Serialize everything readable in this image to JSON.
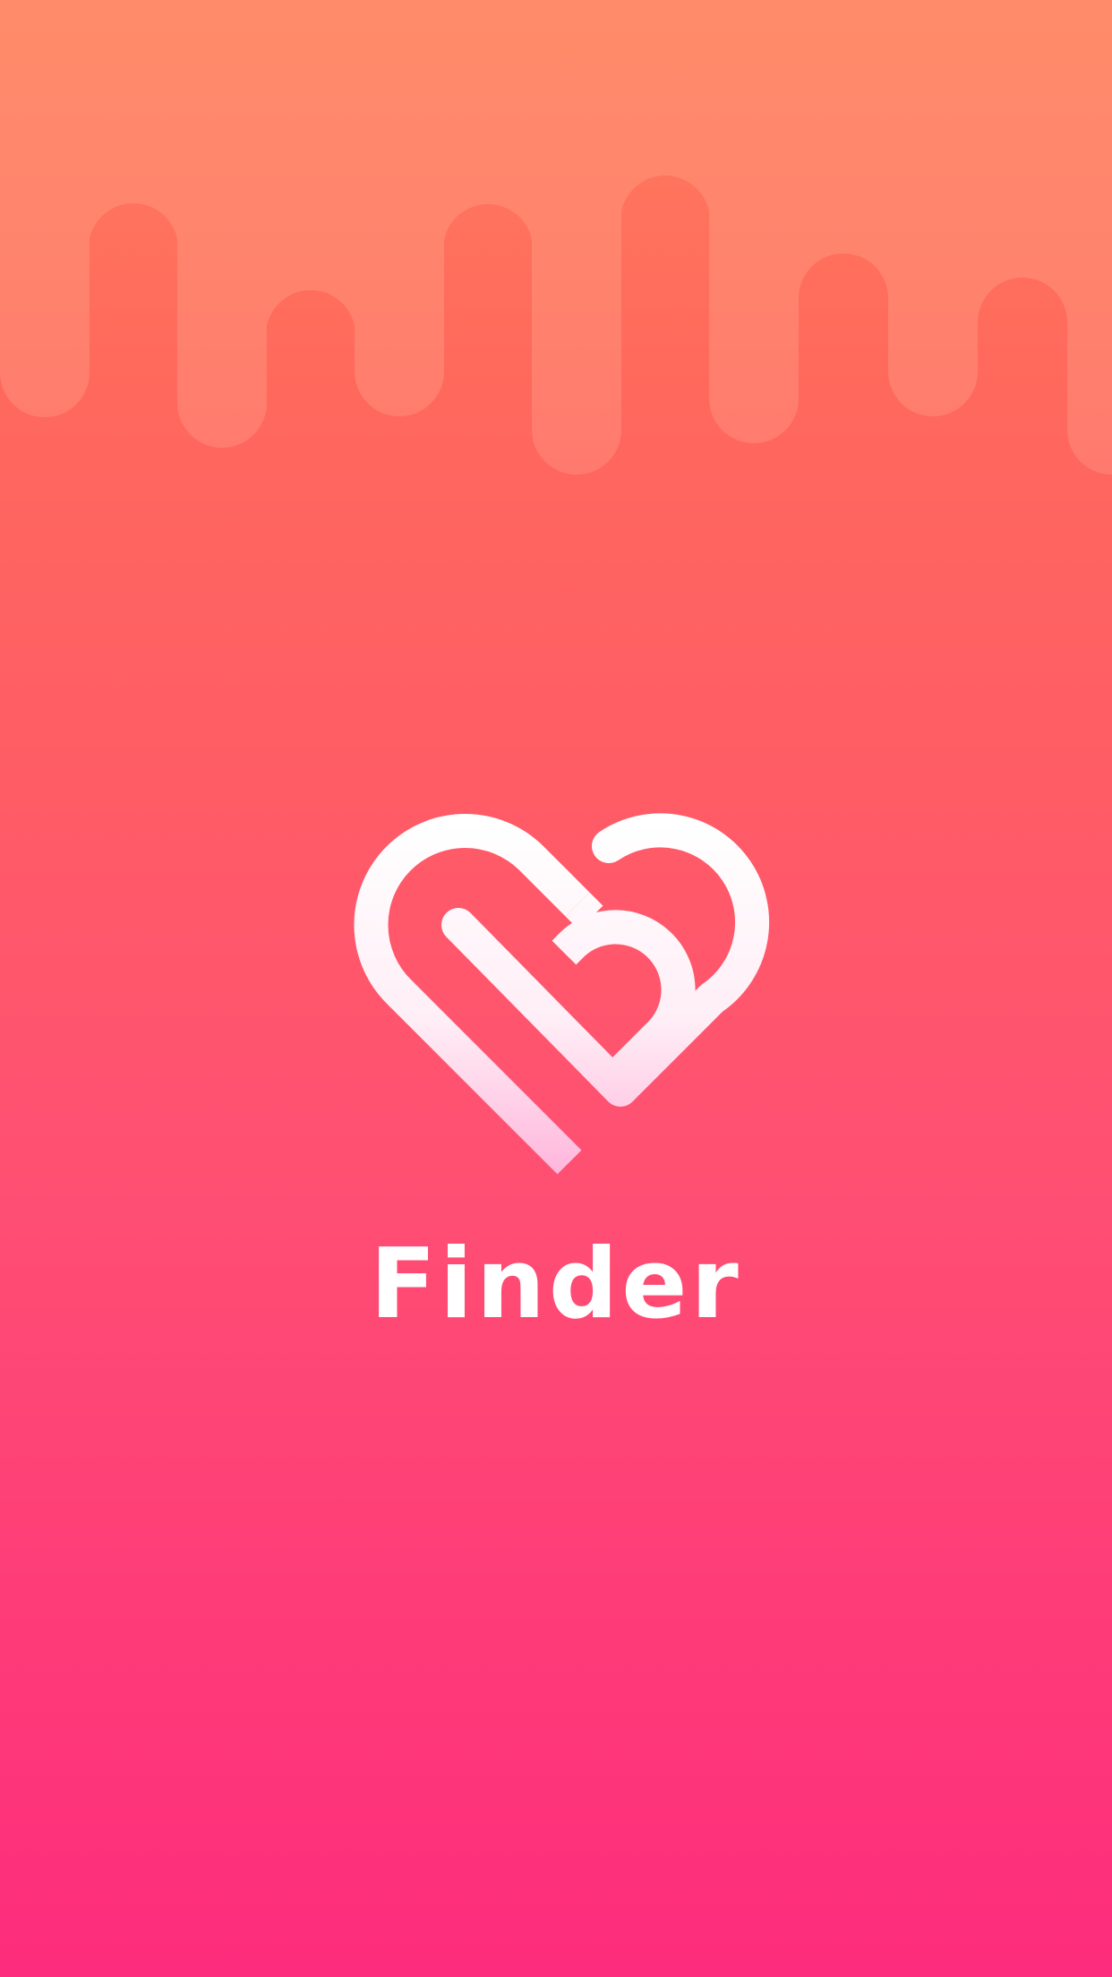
{
  "app": {
    "title": "Finder"
  },
  "colors": {
    "background_top": "#ff7e5e",
    "background_bottom": "#fd2c7c",
    "drip_overlay": "#ff8a70",
    "logo_top": "#ffffff",
    "logo_bottom": "#ffb0d8",
    "title_color": "#ffffff"
  },
  "icons": {
    "logo": "heart-b-logo-icon"
  }
}
